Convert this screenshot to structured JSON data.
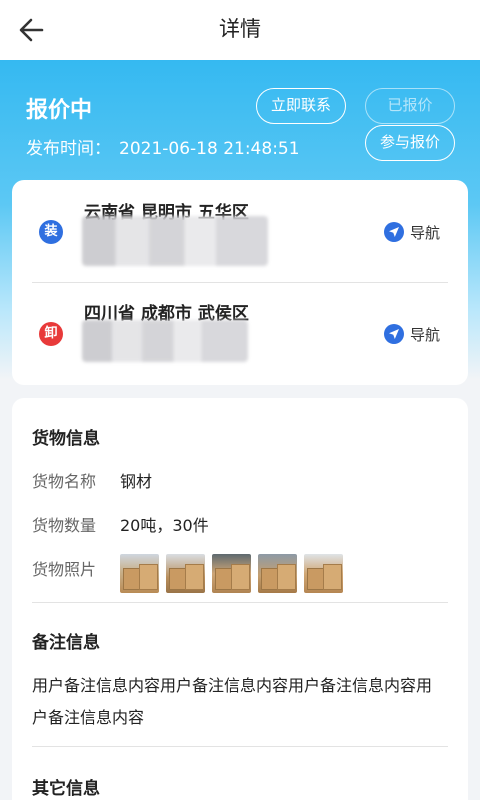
{
  "nav": {
    "title": "详情",
    "back_icon": "back-arrow-icon"
  },
  "order": {
    "status": "报价中",
    "publish_label": "发布时间：",
    "publish_time": "2021-06-18  21:48:51",
    "actions": {
      "contact": "立即联系",
      "quoted": "已报价",
      "join": "参与报价"
    }
  },
  "route": {
    "load": {
      "badge": "装",
      "address": "云南省 昆明市 五华区",
      "nav_label": "导航"
    },
    "unload": {
      "badge": "卸",
      "address": "四川省 成都市 武侯区",
      "nav_label": "导航"
    }
  },
  "cargo": {
    "title": "货物信息",
    "name_label": "货物名称",
    "name_value": "钢材",
    "qty_label": "货物数量",
    "qty_value": "20吨，30件",
    "photos_label": "货物照片",
    "photo_count": 5
  },
  "remark": {
    "title": "备注信息",
    "text": "用户备注信息内容用户备注信息内容用户备注信息内容用户备注信息内容"
  },
  "other": {
    "title": "其它信息"
  },
  "colors": {
    "accent": "#35b9f1",
    "load_badge": "#2f6fe0",
    "unload_badge": "#e83a3a"
  }
}
